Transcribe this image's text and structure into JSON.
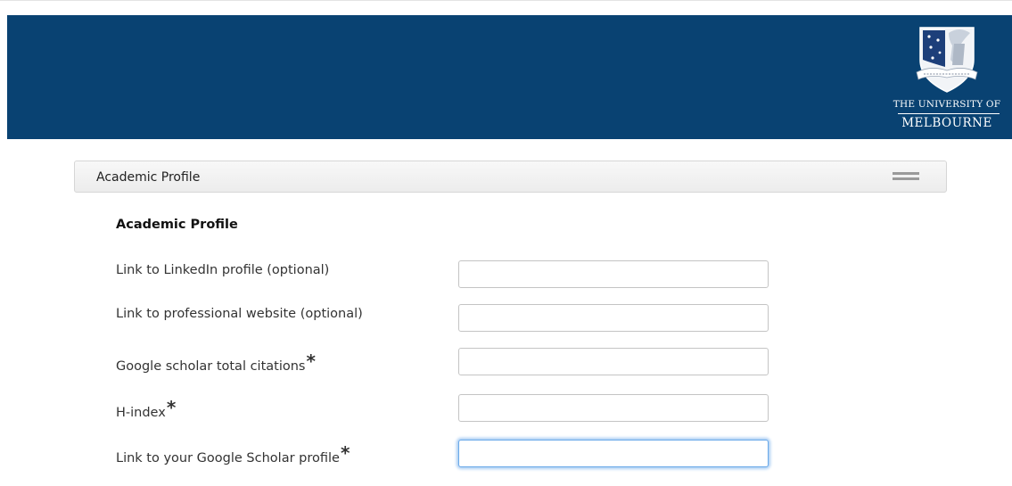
{
  "header": {
    "brand_color": "#094272",
    "logo": {
      "icon": "university-crest-icon",
      "line1": "THE UNIVERSITY OF",
      "line2": "MELBOURNE"
    }
  },
  "section": {
    "title": "Academic Profile",
    "menu_icon": "hamburger-menu-icon"
  },
  "form": {
    "heading": "Academic Profile",
    "fields": [
      {
        "label": "Link to LinkedIn profile (optional)",
        "required": false,
        "value": "",
        "placeholder": ""
      },
      {
        "label": "Link to professional website (optional)",
        "required": false,
        "value": "",
        "placeholder": ""
      },
      {
        "label": "Google scholar total citations",
        "required": true,
        "value": "",
        "placeholder": ""
      },
      {
        "label": "H-index",
        "required": true,
        "value": "",
        "placeholder": ""
      },
      {
        "label": "Link to your Google Scholar profile",
        "required": true,
        "value": "",
        "placeholder": "",
        "focused": true
      }
    ],
    "required_marker": "*"
  }
}
